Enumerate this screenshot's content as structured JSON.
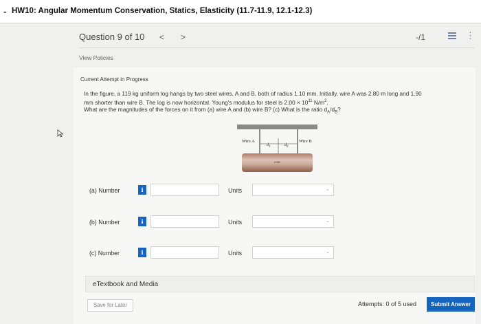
{
  "header": {
    "dash": "-",
    "title": "HW10: Angular Momentum Conservation, Statics, Elasticity (11.7-11.9, 12.1-12.3)"
  },
  "nav": {
    "question": "Question 9 of 10",
    "prev": "<",
    "next": ">",
    "score": "-/1",
    "kebab": "⋮"
  },
  "policies": "View Policies",
  "attempt_status": "Current Attempt in Progress",
  "question": {
    "line1_pre": "In the figure, a 119 kg uniform log hangs by two steel wires, A and B, both of radius 1.10 mm. Initially, wire A was 2.80 m long and 1.90",
    "line2_pre": "mm shorter than wire B. The log is now horizontal. Young's modulus for steel is 2.00 × 10",
    "line2_exp": "11",
    "line2_post": " N/m",
    "line2_sq": "2",
    "line2_end": ".",
    "line3_pre": "What are the magnitudes of the forces on it from (a) wire A and (b) wire B? (c) What is the ratio d",
    "sub_a": "A",
    "slash": "/d",
    "sub_b": "B",
    "line3_end": "?"
  },
  "figure": {
    "wire_a": "Wire A",
    "wire_b": "Wire B",
    "da": "d",
    "da_sub": "A",
    "db": "d",
    "db_sub": "B",
    "com": "com"
  },
  "answers": [
    {
      "label": "(a)  Number",
      "info": "i",
      "units_label": "Units",
      "value": "",
      "units": ""
    },
    {
      "label": "(b)  Number",
      "info": "i",
      "units_label": "Units",
      "value": "",
      "units": ""
    },
    {
      "label": "(c)  Number",
      "info": "i",
      "units_label": "Units",
      "value": "",
      "units": ""
    }
  ],
  "etextbook": "eTextbook and Media",
  "save_label": "Save for Later",
  "attempts": "Attempts: 0 of 5 used",
  "submit_label": "Submit Answer",
  "colors": {
    "accent": "#1565c0",
    "background": "#f0f0ee"
  }
}
